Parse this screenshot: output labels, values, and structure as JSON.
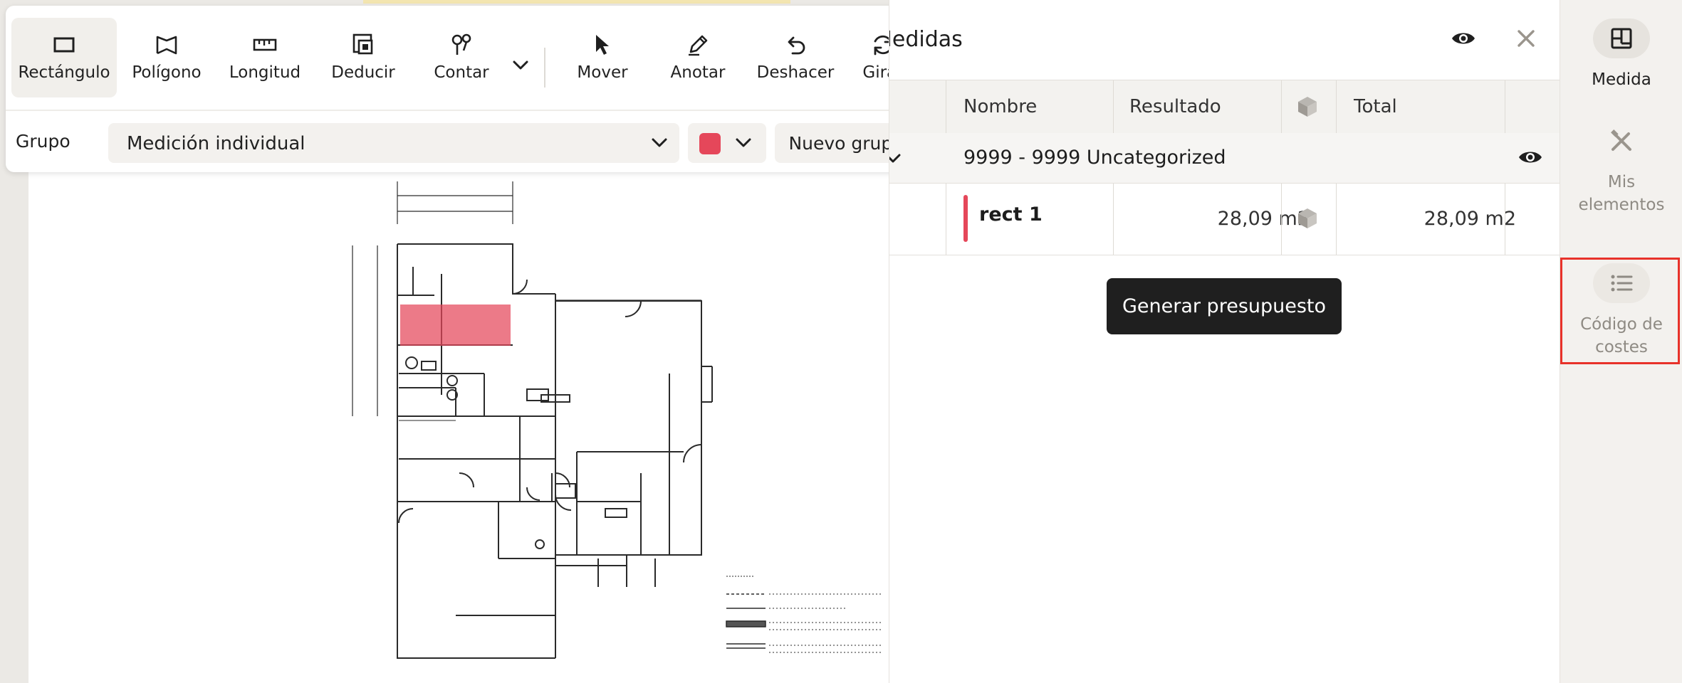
{
  "toolbar": {
    "tools": [
      {
        "id": "rectangle",
        "label": "Rectángulo",
        "icon": "rectangle-icon",
        "active": true
      },
      {
        "id": "polygon",
        "label": "Polígono",
        "icon": "polygon-icon",
        "active": false
      },
      {
        "id": "length",
        "label": "Longitud",
        "icon": "ruler-icon",
        "active": false
      },
      {
        "id": "deduct",
        "label": "Deducir",
        "icon": "deduct-icon",
        "active": false
      },
      {
        "id": "count",
        "label": "Contar",
        "icon": "count-icon",
        "active": false
      },
      {
        "id": "move",
        "label": "Mover",
        "icon": "cursor-icon",
        "active": false
      },
      {
        "id": "annotate",
        "label": "Anotar",
        "icon": "pen-icon",
        "active": false
      },
      {
        "id": "undo",
        "label": "Deshacer",
        "icon": "undo-icon",
        "active": false
      },
      {
        "id": "rotate",
        "label": "Girar",
        "icon": "rotate-icon",
        "active": false
      }
    ],
    "group_label": "Grupo",
    "group_value": "Medición individual",
    "color": "#e5475a",
    "new_group_label": "Nuevo grupo"
  },
  "measurements": {
    "title": "Medidas",
    "columns": {
      "name": "Nombre",
      "result": "Resultado",
      "total": "Total"
    },
    "groups": [
      {
        "name": "9999 - 9999 Uncategorized",
        "items": [
          {
            "name": "rect 1",
            "result": "28,09 m2",
            "total": "28,09 m2",
            "color": "#e5475a"
          }
        ]
      }
    ],
    "generate_budget_label": "Generar presupuesto"
  },
  "sidebar": {
    "items": [
      {
        "id": "measure",
        "label": "Medida",
        "icon": "layout-icon",
        "active": true
      },
      {
        "id": "my-elements",
        "label_line1": "Mis",
        "label_line2": "elementos",
        "icon": "tools-icon",
        "active": false
      },
      {
        "id": "cost-codes",
        "label_line1": "Código de",
        "label_line2": "costes",
        "icon": "list-icon",
        "active": false,
        "highlighted": true
      }
    ]
  },
  "colors": {
    "accent_dark": "#1f1f1f",
    "measure_fill": "#e5475a",
    "highlight_border": "#e8322a"
  }
}
